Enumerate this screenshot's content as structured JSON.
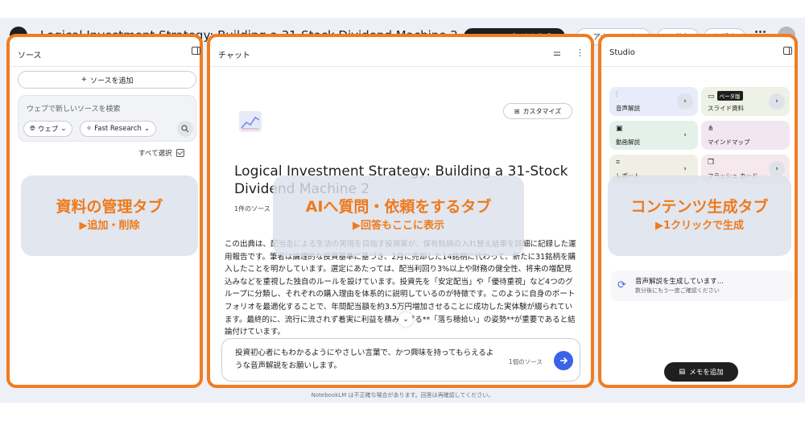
{
  "header": {
    "title": "Logical Investment Strategy: Building a 31-Stock Dividend Machine 2",
    "new_notebook_label": "ノートブックを作成",
    "analytics_label": "アナリティクス",
    "share_label": "共有",
    "settings_label": "設定"
  },
  "sources": {
    "heading": "ソース",
    "add_label": "ソースを追加",
    "search_placeholder": "ウェブで新しいソースを検索",
    "chip_web": "ウェブ",
    "chip_research": "Fast Research",
    "select_all": "すべて選択",
    "overlay_title": "資料の管理タブ",
    "overlay_sub": "▶追加・削除"
  },
  "chat": {
    "heading": "チャット",
    "customize_label": "カスタマイズ",
    "title": "Logical Investment Strategy: Building a 31-Stock Dividend Machine 2",
    "sub": "1件のソース",
    "body": "この出典は、配当金による生活の実現を目指す投資家が、保有銘柄の入れ替え結果を詳細に記録した運用報告です。筆者は論理的な投資基準に基づき、2月に売却した14銘柄に代わって、新たに31銘柄を購入したことを明かしています。選定にあたっては、配当利回り3%以上や財務の健全性、将来の増配見込みなどを重視した独自のルールを設けています。投資先を「安定配当」や「優待重視」など4つのグループに分類し、それぞれの購入理由を体系的に説明しているのが特徴です。このように自身のポートフォリオを最適化することで、年間配当額を約3.5万円増加させることに成功した実体験が綴られています。最終的に、流行に流されず着実に利益を積み上げる**「落ち穂拾い」の姿勢**が重要であると結論付けています。",
    "input_text": "投資初心者にもわかるようにやさしい言葉で、かつ興味を持ってもらえるような音声解説をお願いします。",
    "source_count": "1個のソース",
    "overlay_title": "AIへ質問・依頼をするタブ",
    "overlay_sub": "▶回答もここに表示"
  },
  "studio": {
    "heading": "Studio",
    "tiles": [
      {
        "label": "音声解説",
        "color": "#e8ecfa"
      },
      {
        "label": "スライド資料",
        "badge": "ベータ版",
        "color": "#eef1e6"
      },
      {
        "label": "動画解説",
        "color": "#e4f1ea"
      },
      {
        "label": "マインドマップ",
        "color": "#f2e7f0"
      },
      {
        "label": "レポート",
        "color": "#efefe6"
      },
      {
        "label": "フラッシュ カード",
        "color": "#f6e9ee"
      }
    ],
    "audio_title": "音声解説を生成しています...",
    "audio_sub": "数分後にもう一度ご確認ください",
    "memo_label": "メモを追加",
    "overlay_title": "コンテンツ生成タブ",
    "overlay_sub": "▶1クリックで生成"
  },
  "footer": "NotebookLM は不正確な場合があります。回答は再確認してください。"
}
